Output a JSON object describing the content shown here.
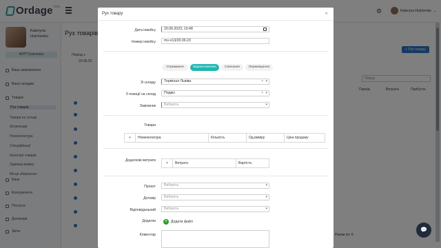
{
  "topbar": {
    "logo_text": "Ordage",
    "beta": "beta",
    "user_name": "Kateryna Hulchenko"
  },
  "sidebar": {
    "user_name_line1": "Kateryna",
    "user_name_line2": "Hulchenko",
    "company": "ФОП Гульченко",
    "items": [
      {
        "label": "Ваші замовлення"
      },
      {
        "label": "Ваші складки"
      },
      {
        "label": "Товари"
      },
      {
        "label": "Банк"
      },
      {
        "label": "Контрагенти"
      },
      {
        "label": "Послуги"
      },
      {
        "label": "Договори"
      },
      {
        "label": "Звіти"
      }
    ],
    "subitems": [
      {
        "label": "Рух товарів"
      },
      {
        "label": "Товари на складі"
      },
      {
        "label": "Штрихкоди"
      },
      {
        "label": "Номенклатура"
      },
      {
        "label": "Специфікації"
      },
      {
        "label": "Категорії товарів"
      },
      {
        "label": "Одиниці виміру"
      },
      {
        "label": "Місця зберігання"
      }
    ]
  },
  "main": {
    "title": "Рух товарів",
    "period_label": "Період з",
    "date_value": "20.06.20",
    "add_button": "+ Рух товару",
    "search_placeholder": "Пошук",
    "columns": [
      "Прихід",
      "Витрата",
      "Прибуток"
    ],
    "total_row": "Разом по: 6"
  },
  "modal": {
    "title": "Рух товару",
    "close": "×",
    "fields": {
      "doc_date_label": "Дата інвойсу",
      "doc_date_value": "20.06.2023, 10:48",
      "doc_number_label": "Номер інвойсу",
      "doc_number_value": "mv-o13/20.06.23",
      "from_warehouse_label": "Зі складу",
      "from_warehouse_value": "Термінал Львіва",
      "to_warehouse_label": "З позиції на склад",
      "to_warehouse_value": "Подвіз",
      "customer_label": "Замовник",
      "customer_placeholder": "Виберіть"
    },
    "tabs": [
      {
        "label": "Отримання",
        "active": false
      },
      {
        "label": "Відвантаження",
        "active": true
      },
      {
        "label": "Списання",
        "active": false
      },
      {
        "label": "Переміщення",
        "active": false
      }
    ],
    "goods": {
      "section_label": "Товари",
      "columns": [
        "Номенклатура",
        "Кількість",
        "Од.виміру",
        "Ціна продажу"
      ]
    },
    "extra_costs": {
      "section_label": "Додаткові витрати",
      "columns": [
        "Витрата",
        "Вартість"
      ]
    },
    "details": {
      "project_label": "Проєкт",
      "contract_label": "Договір",
      "responsible_label": "Відповідальний",
      "placeholder": "Виберіть",
      "attachments_label": "Додатки",
      "attach_button": "Додати файл",
      "comment_label": "Коментар"
    }
  },
  "colors": {
    "accent": "#20b7b2",
    "primary": "#2f72c2",
    "required": "#e54848",
    "plus": "#2a9d2a"
  }
}
